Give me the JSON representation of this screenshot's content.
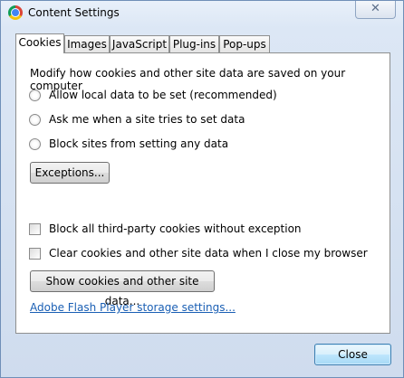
{
  "window": {
    "title": "Content Settings",
    "close_symbol": "✕"
  },
  "tabs": [
    {
      "label": "Cookies",
      "active": true
    },
    {
      "label": "Images",
      "active": false
    },
    {
      "label": "JavaScript",
      "active": false
    },
    {
      "label": "Plug-ins",
      "active": false
    },
    {
      "label": "Pop-ups",
      "active": false
    }
  ],
  "cookies": {
    "description": "Modify how cookies and other site data are saved on your computer",
    "radio_options": [
      "Allow local data to be set (recommended)",
      "Ask me when a site tries to set data",
      "Block sites from setting any data"
    ],
    "exceptions_label": "Exceptions...",
    "checkboxes": [
      "Block all third-party cookies without exception",
      "Clear cookies and other site data when I close my browser"
    ],
    "show_cookies_label": "Show cookies and other site data...",
    "flash_link": "Adobe Flash Player storage settings..."
  },
  "footer": {
    "close_label": "Close"
  }
}
